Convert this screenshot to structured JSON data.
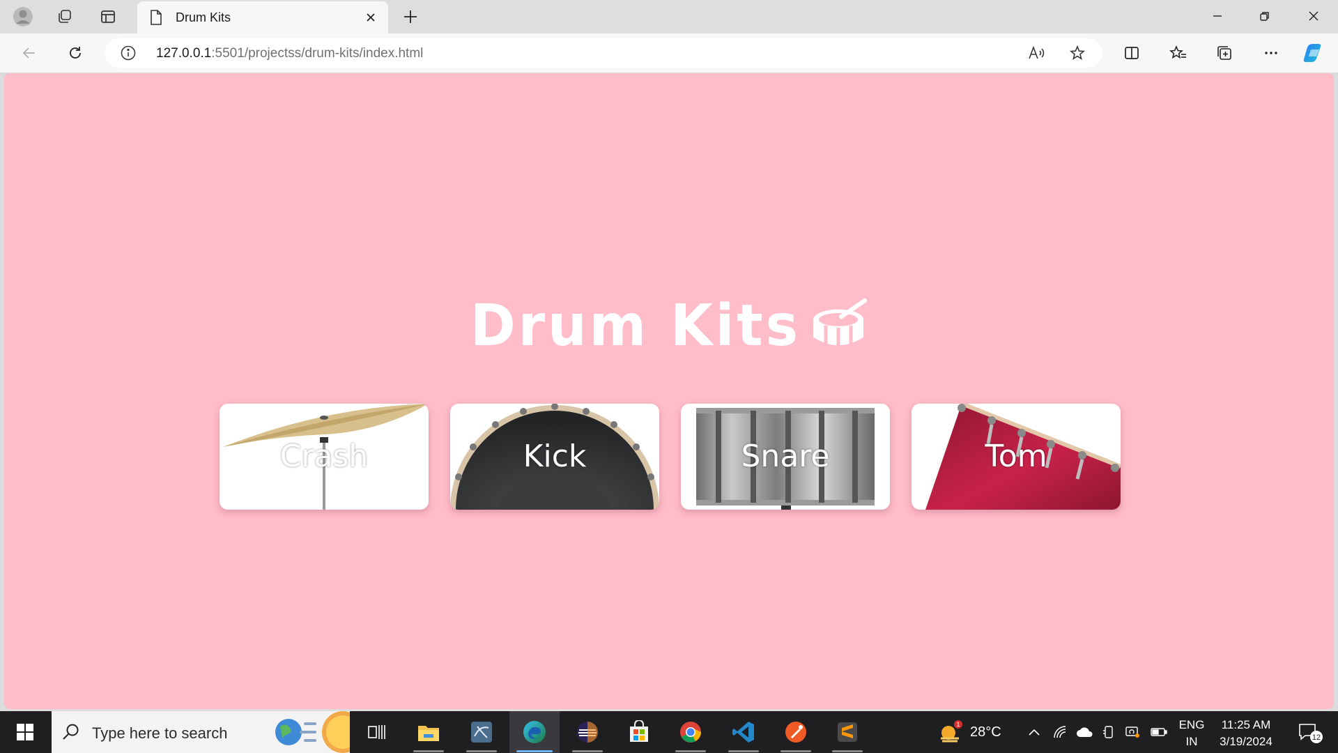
{
  "browser": {
    "tab_title": "Drum Kits",
    "url_host": "127.0.0.1",
    "url_rest": ":5501/projectss/drum-kits/index.html"
  },
  "page": {
    "title": "Drum Kits",
    "pads": [
      {
        "label": "Crash",
        "color": "#d8c08c"
      },
      {
        "label": "Kick",
        "color": "#2e2f31"
      },
      {
        "label": "Snare",
        "color": "#9a9a9a"
      },
      {
        "label": "Tom",
        "color": "#b8213f"
      }
    ],
    "background": "#ffbdc9"
  },
  "taskbar": {
    "search_placeholder": "Type here to search",
    "weather_temp": "28°C",
    "weather_badge": "1",
    "lang_line1": "ENG",
    "lang_line2": "IN",
    "time": "11:25 AM",
    "date": "3/19/2024",
    "notifications": "12"
  }
}
